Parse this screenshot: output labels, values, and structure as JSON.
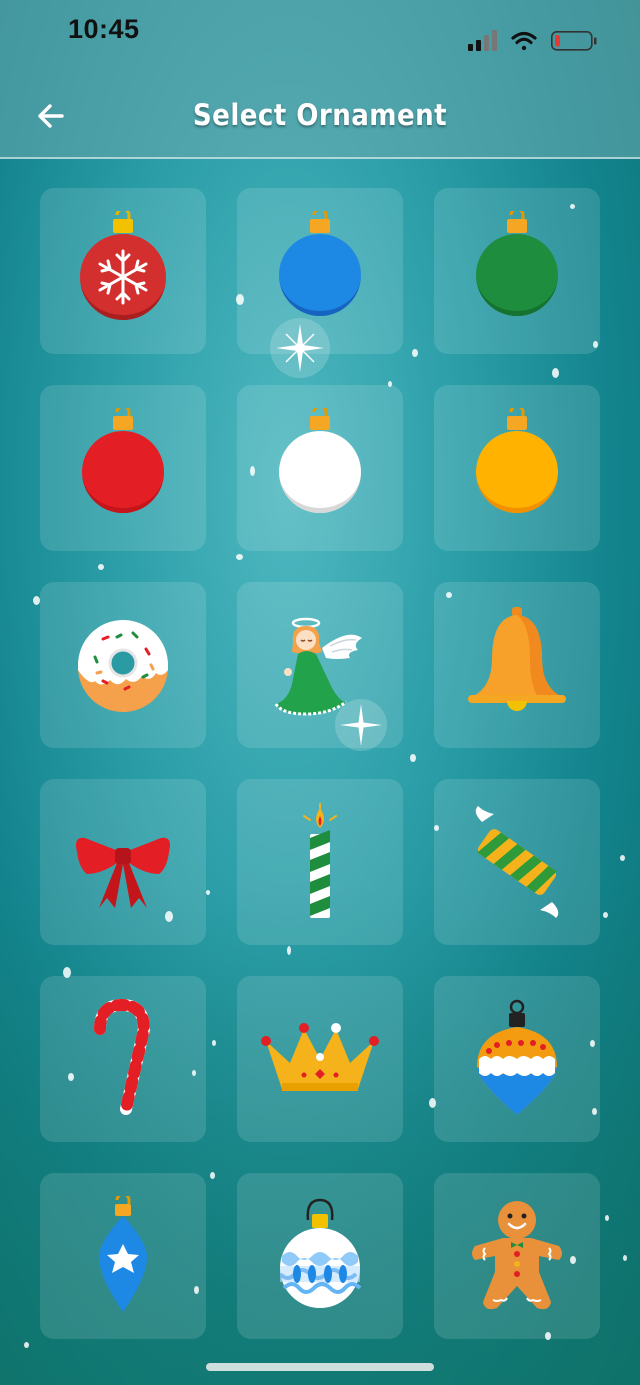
{
  "status_bar": {
    "time": "10:45",
    "icons": [
      "cellular-signal-icon",
      "wifi-icon",
      "battery-low-icon"
    ],
    "battery_color": "#e53935"
  },
  "header": {
    "title": "Select Ornament",
    "back_icon": "arrow-left-icon"
  },
  "colors": {
    "background": "#1f9aa3",
    "tile_bg": "rgba(255,255,255,0.13)",
    "title_text": "#ffffff"
  },
  "ornaments": [
    {
      "name": "red-snowflake-bauble-icon",
      "color": "#d32f2f"
    },
    {
      "name": "blue-bauble-icon",
      "color": "#1e88e5"
    },
    {
      "name": "green-bauble-icon",
      "color": "#1e8e3e"
    },
    {
      "name": "red-bauble-icon",
      "color": "#e31e24"
    },
    {
      "name": "white-bauble-icon",
      "color": "#ffffff"
    },
    {
      "name": "yellow-bauble-icon",
      "color": "#ffb300"
    },
    {
      "name": "donut-icon",
      "color": "#ffffff"
    },
    {
      "name": "angel-icon",
      "color": "#22a24a"
    },
    {
      "name": "bell-icon",
      "color": "#f7a12b"
    },
    {
      "name": "red-bow-icon",
      "color": "#e31e24"
    },
    {
      "name": "candle-icon",
      "color": "#1e8e3e"
    },
    {
      "name": "wrapped-candy-icon",
      "color": "#2e9a3a"
    },
    {
      "name": "candy-cane-icon",
      "color": "#e31e24"
    },
    {
      "name": "crown-icon",
      "color": "#f5b21b"
    },
    {
      "name": "onion-bauble-icon",
      "color": "#f39c12"
    },
    {
      "name": "blue-star-drop-ornament-icon",
      "color": "#1e88e5"
    },
    {
      "name": "blue-pattern-bauble-icon",
      "color": "#64b5f6"
    },
    {
      "name": "gingerbread-man-icon",
      "color": "#e8913a"
    }
  ]
}
